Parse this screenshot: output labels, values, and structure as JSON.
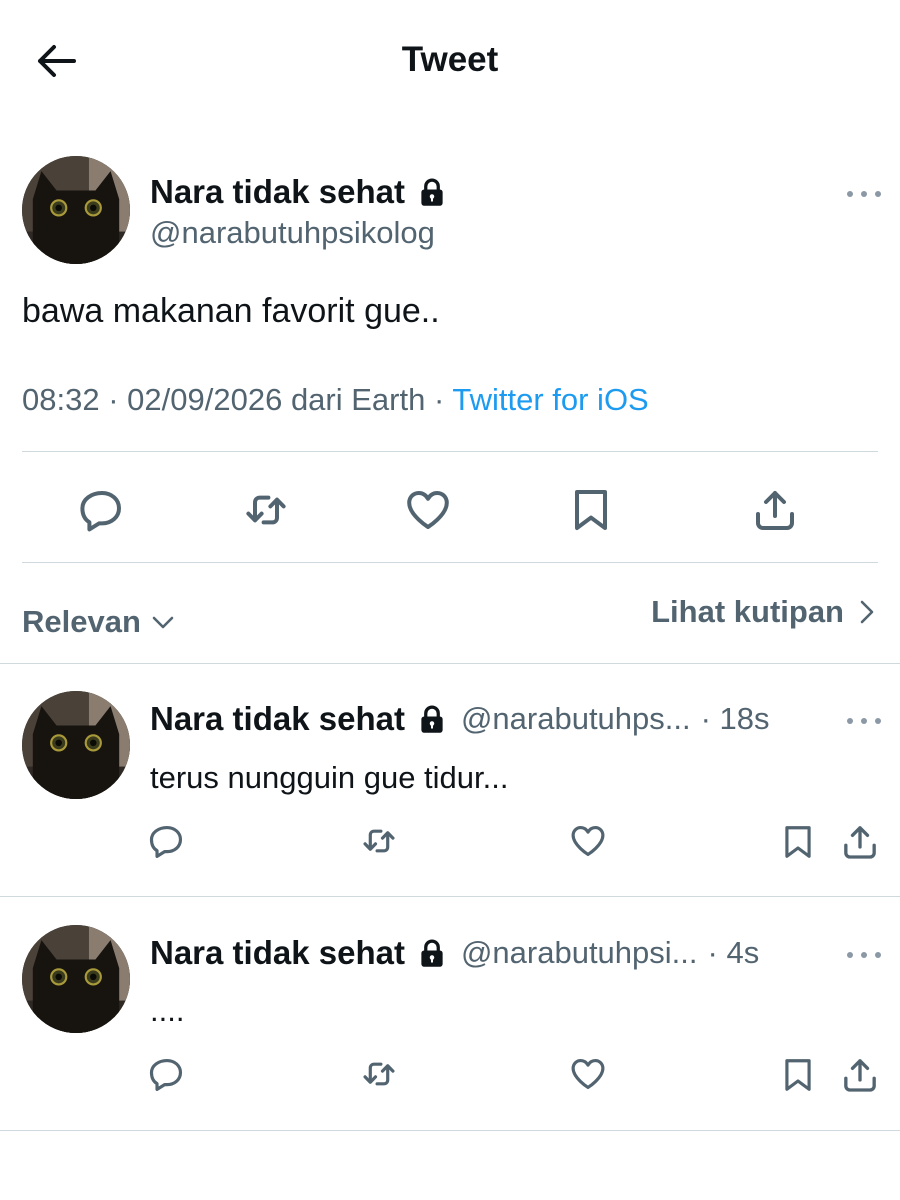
{
  "header": {
    "title": "Tweet"
  },
  "tweet": {
    "author": {
      "name": "Nara tidak sehat",
      "handle": "@narabutuhpsikolog"
    },
    "text": "bawa makanan favorit gue..",
    "time": "08:32",
    "date": "02/09/2026",
    "location": "dari Earth",
    "separator": "·",
    "client": "Twitter for iOS"
  },
  "filters": {
    "sort_label": "Relevan",
    "quotes_label": "Lihat kutipan"
  },
  "replies": [
    {
      "name": "Nara tidak sehat",
      "handle": "@narabutuhps...",
      "time": "· 18s",
      "text": "terus nungguin gue tidur..."
    },
    {
      "name": "Nara tidak sehat",
      "handle": "@narabutuhpsi...",
      "time": "· 4s",
      "text": "...."
    }
  ],
  "colors": {
    "text": "#0f1419",
    "secondary": "#536471",
    "accent": "#1d9bf0",
    "divider": "#cfd9de"
  },
  "icons": [
    "back-arrow-icon",
    "lock-icon",
    "more-icon",
    "reply-icon",
    "retweet-icon",
    "like-icon",
    "bookmark-icon",
    "share-icon",
    "chevron-down-icon",
    "chevron-right-icon"
  ]
}
